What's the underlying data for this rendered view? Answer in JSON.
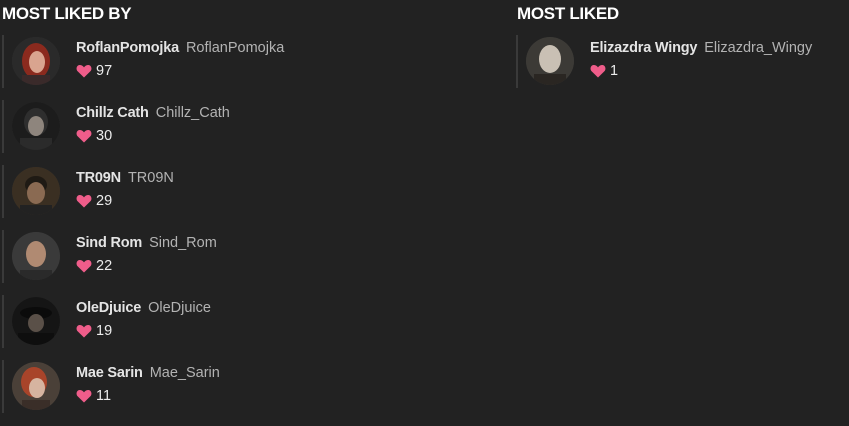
{
  "most_liked_by": {
    "title": "MOST LIKED BY",
    "users": [
      {
        "display_name": "RoflanPomojka",
        "username": "RoflanPomojka",
        "likes": "97",
        "avatar": "red-hair-woman"
      },
      {
        "display_name": "Chillz Cath",
        "username": "Chillz_Cath",
        "likes": "30",
        "avatar": "dark-hair-man"
      },
      {
        "display_name": "TR09N",
        "username": "TR09N",
        "likes": "29",
        "avatar": "dark-man"
      },
      {
        "display_name": "Sind Rom",
        "username": "Sind_Rom",
        "likes": "22",
        "avatar": "bald-man"
      },
      {
        "display_name": "OleDjuice",
        "username": "OleDjuice",
        "likes": "19",
        "avatar": "hat-man"
      },
      {
        "display_name": "Mae Sarin",
        "username": "Mae_Sarin",
        "likes": "11",
        "avatar": "red-hair-woman-2"
      }
    ]
  },
  "most_liked": {
    "title": "MOST LIKED",
    "users": [
      {
        "display_name": "Elizazdra Wingy",
        "username": "Elizazdra_Wingy",
        "likes": "1",
        "avatar": "bald-pale"
      }
    ]
  },
  "colors": {
    "background": "#222222",
    "heart": "#ef5d8a",
    "title": "#ffffff"
  }
}
